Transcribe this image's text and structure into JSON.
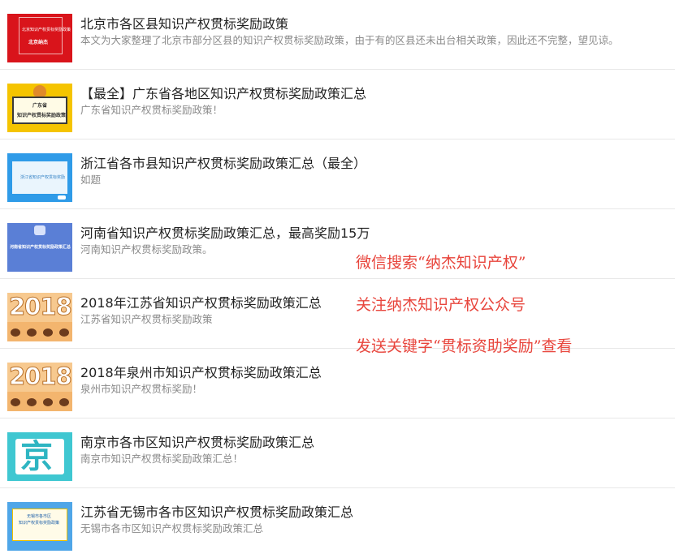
{
  "articles": [
    {
      "title": "北京市各区县知识产权贯标奖励政策",
      "desc": "本文为大家整理了北京市部分区县的知识产权贯标奖励政策，由于有的区县还未出台相关政策，因此还不完整，望见谅。",
      "thumb": {
        "line1": "北京知识产权贯标奖励政策",
        "line2": "北京纳杰"
      }
    },
    {
      "title": "【最全】广东省各地区知识产权贯标奖励政策汇总",
      "desc": "广东省知识产权贯标奖励政策！",
      "thumb": {
        "line1": "广东省",
        "line2": "知识产权贯标奖励政策"
      }
    },
    {
      "title": "浙江省各市县知识产权贯标奖励政策汇总（最全）",
      "desc": "如题",
      "thumb": {
        "line1": "浙江省知识产权贯标奖励"
      }
    },
    {
      "title": "河南省知识产权贯标奖励政策汇总，最高奖励15万",
      "desc": "河南知识产权贯标奖励政策。",
      "thumb": {
        "line1": "河南省知识产权贯标奖励政策汇总"
      }
    },
    {
      "title": "2018年江苏省知识产权贯标奖励政策汇总",
      "desc": "江苏省知识产权贯标奖励政策",
      "thumb": {
        "line1": "2018"
      }
    },
    {
      "title": "2018年泉州市知识产权贯标奖励政策汇总",
      "desc": "泉州市知识产权贯标奖励！",
      "thumb": {
        "line1": "2018"
      }
    },
    {
      "title": "南京市各市区知识产权贯标奖励政策汇总",
      "desc": "南京市知识产权贯标奖励政策汇总！",
      "thumb": {
        "line1": "京"
      }
    },
    {
      "title": "江苏省无锡市各市区知识产权贯标奖励政策汇总",
      "desc": "无锡市各市区知识产权贯标奖励政策汇总",
      "thumb": {
        "line1": "无锡市各市区",
        "line2": "知识产权贯标奖励政策"
      }
    }
  ],
  "overlay": {
    "line1": "微信搜索“纳杰知识产权”",
    "line2": "关注纳杰知识产权公众号",
    "line3": "发送关键字“贯标资助奖励”查看"
  },
  "colors": {
    "overlay_text": "#e8453c",
    "title": "#222222",
    "desc": "#8a8a8a"
  }
}
